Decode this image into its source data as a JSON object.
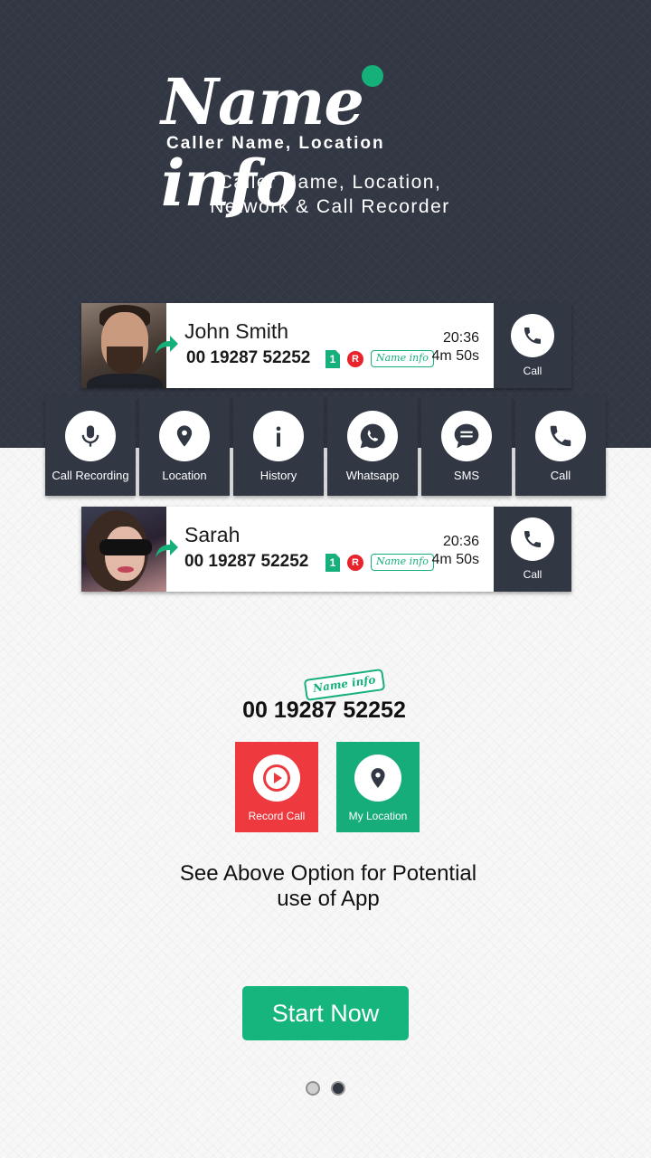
{
  "header": {
    "logo_text": "Name info",
    "logo_subtitle": "Caller Name, Location",
    "tagline_line1": "Caller Name, Location,",
    "tagline_line2": "Network & Call Recorder"
  },
  "callers": [
    {
      "name": "John Smith",
      "number": "00 19287 52252",
      "sim": "1",
      "network_badge": "R",
      "brand_badge": "Name info",
      "time": "20:36",
      "duration": "4m 50s",
      "call_label": "Call"
    },
    {
      "name": "Sarah",
      "number": "00 19287 52252",
      "sim": "1",
      "network_badge": "R",
      "brand_badge": "Name info",
      "time": "20:36",
      "duration": "4m 50s",
      "call_label": "Call"
    }
  ],
  "actions": [
    {
      "label": "Call Recording",
      "icon": "microphone-icon"
    },
    {
      "label": "Location",
      "icon": "location-pin-icon"
    },
    {
      "label": "History",
      "icon": "info-icon"
    },
    {
      "label": "Whatsapp",
      "icon": "whatsapp-icon"
    },
    {
      "label": "SMS",
      "icon": "chat-bubble-icon"
    },
    {
      "label": "Call",
      "icon": "phone-icon"
    }
  ],
  "demo": {
    "brand_badge": "Name info",
    "number": "00 19287 52252",
    "record_label": "Record Call",
    "location_label": "My Location"
  },
  "description_line1": "See Above Option for Potential",
  "description_line2": "use of App",
  "start_button": "Start Now",
  "pager": {
    "pages": 2,
    "active_index": 1
  },
  "colors": {
    "dark": "#323744",
    "green": "#17b57e",
    "red": "#ee3a3f"
  }
}
